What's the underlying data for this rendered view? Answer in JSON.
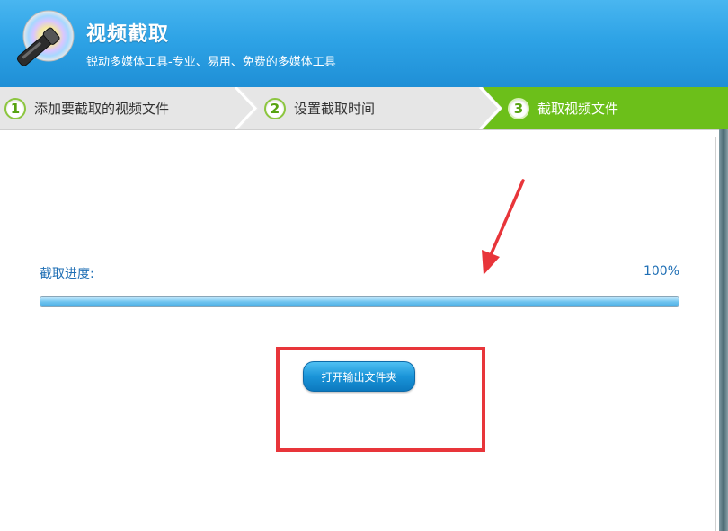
{
  "header": {
    "title": "视频截取",
    "subtitle": "锐动多媒体工具-专业、易用、免费的多媒体工具",
    "icon": "cd-wand-icon",
    "bg_color": "#2ea3e6"
  },
  "steps": [
    {
      "num": "1",
      "label": "添加要截取的视频文件",
      "active": false
    },
    {
      "num": "2",
      "label": "设置截取时间",
      "active": false
    },
    {
      "num": "3",
      "label": "截取视频文件",
      "active": true
    }
  ],
  "step_colors": {
    "inactive": "#e9e9e9",
    "active": "#6cbf1a"
  },
  "progress": {
    "label": "截取进度:",
    "percent_text": "100%",
    "value": 1.0
  },
  "open_folder_button": {
    "label": "打开输出文件夹"
  },
  "annotations": {
    "arrow_color": "#e8353a",
    "box_color": "#e8353a"
  }
}
